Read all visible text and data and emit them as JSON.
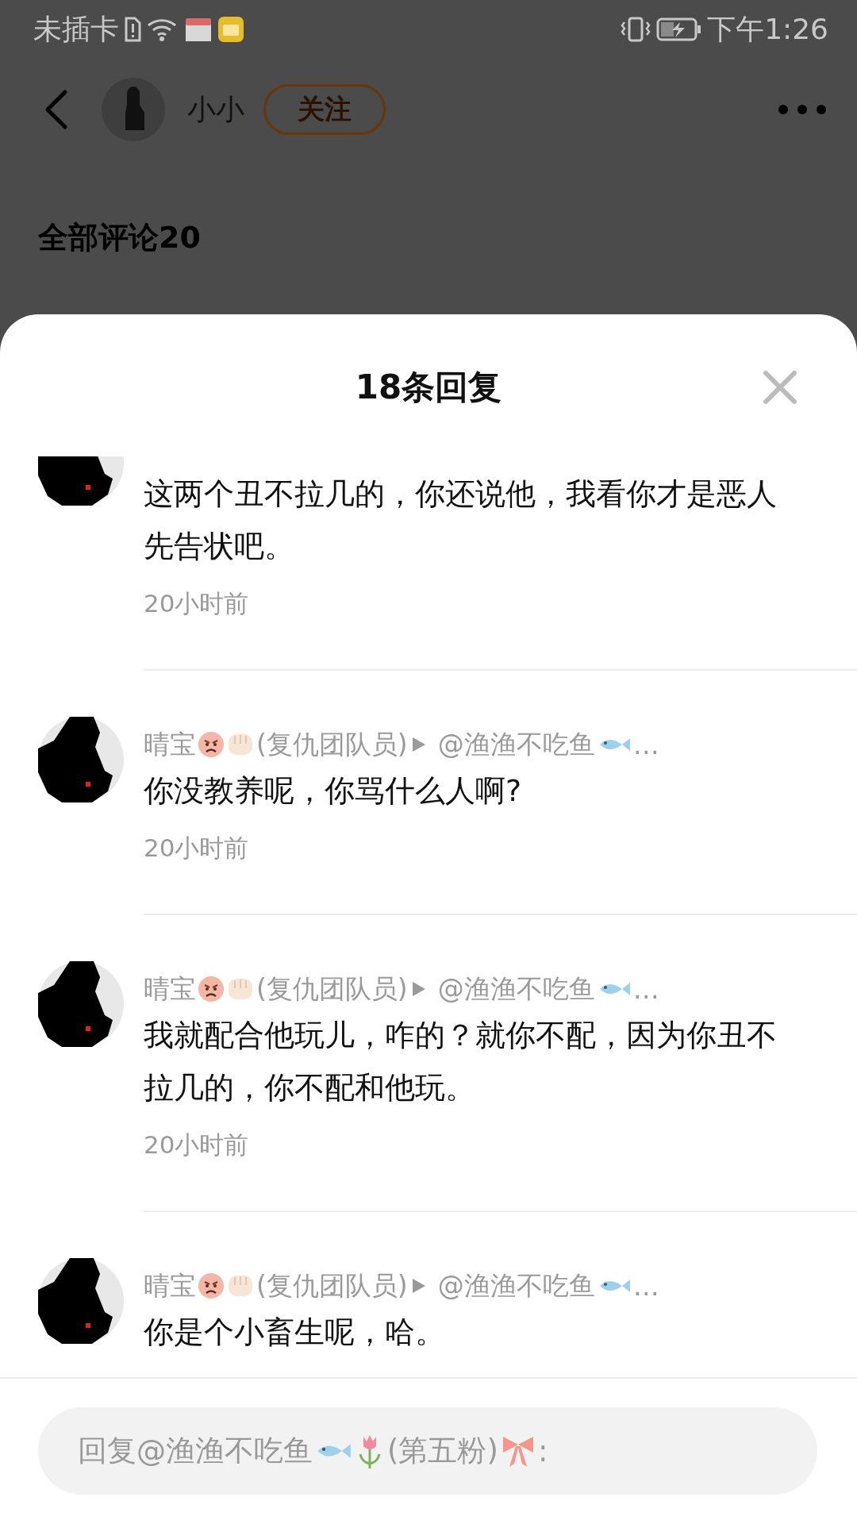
{
  "status_bar": {
    "carrier": "未插卡",
    "time": "下午1:26"
  },
  "header": {
    "username": "小小",
    "follow_label": "关注"
  },
  "comments_heading": "全部评论20",
  "sheet": {
    "title": "18条回复",
    "replies": [
      {
        "text": "这两个丑不拉几的，你还说他，我看你才是恶人先告状吧。",
        "time": "20小时前"
      },
      {
        "name": "晴宝",
        "team": "(复仇团队员)",
        "target": "@渔渔不吃鱼",
        "more": "…",
        "text": "你没教养呢，你骂什么人啊?",
        "time": "20小时前"
      },
      {
        "name": "晴宝",
        "team": "(复仇团队员)",
        "target": "@渔渔不吃鱼",
        "more": "…",
        "text": "我就配合他玩儿，咋的？就你不配，因为你丑不拉几的，你不配和他玩。",
        "time": "20小时前"
      },
      {
        "name": "晴宝",
        "team": "(复仇团队员)",
        "target": "@渔渔不吃鱼",
        "more": "…",
        "text": "你是个小畜生呢，哈。"
      }
    ]
  },
  "reply_box": {
    "placeholder_start": "回复@渔渔不吃鱼",
    "placeholder_middle": "(第五粉)",
    "placeholder_end": ":"
  }
}
